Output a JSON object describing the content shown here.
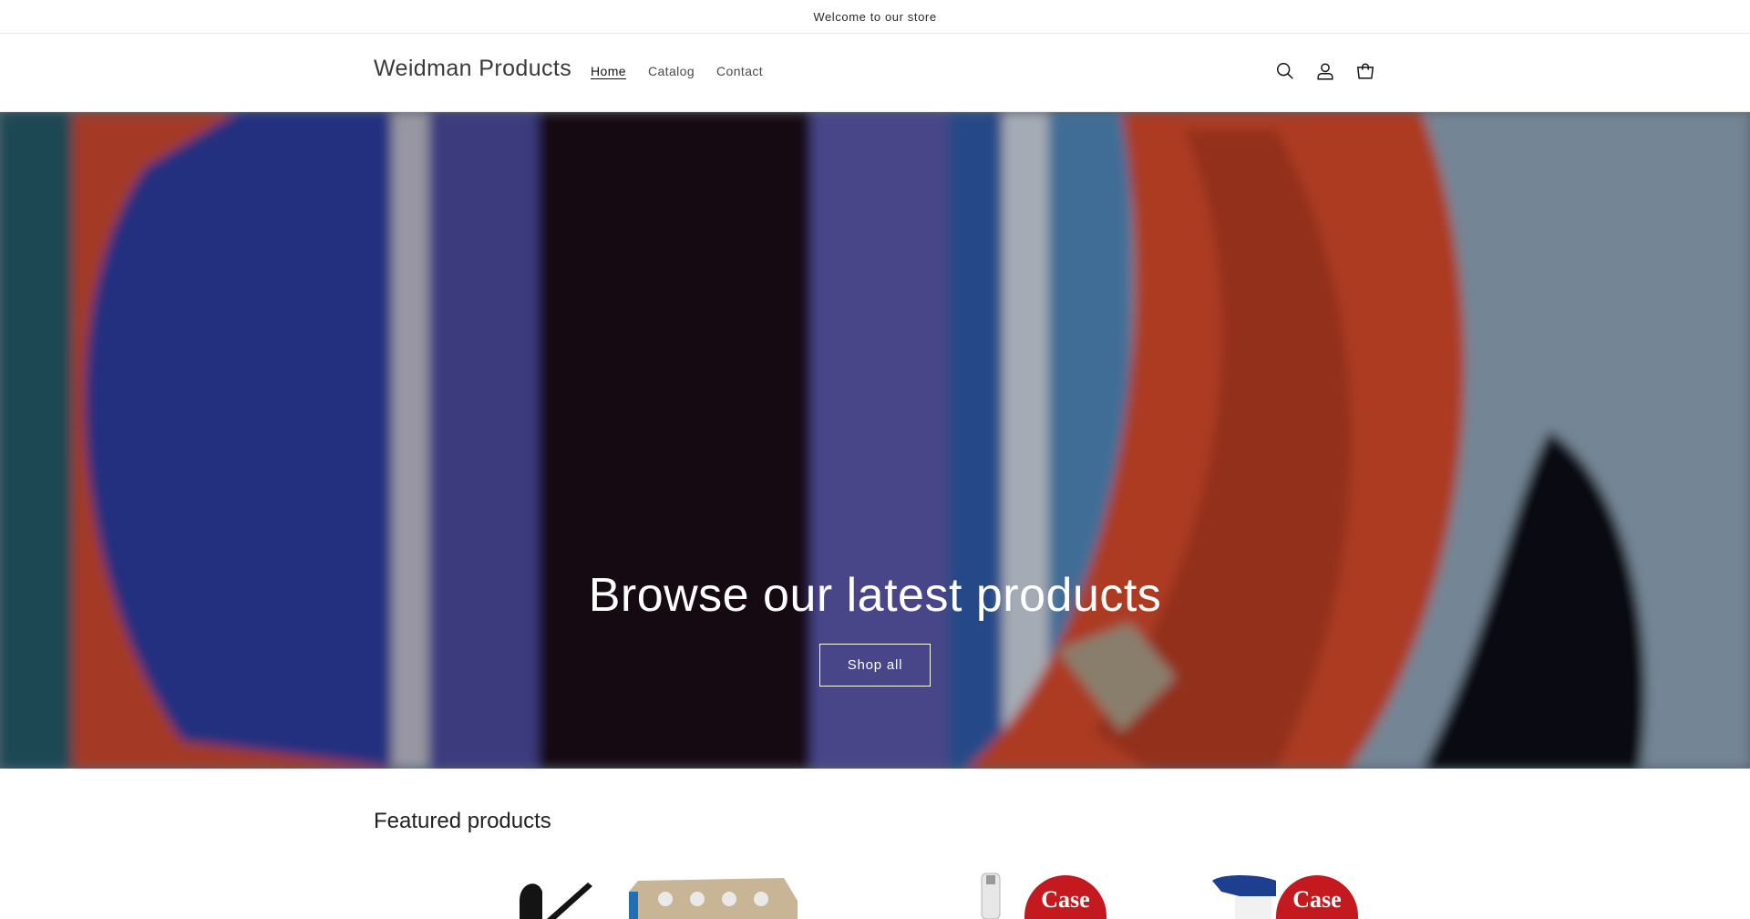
{
  "announcement": {
    "text": "Welcome to our store"
  },
  "header": {
    "logo": "Weidman Products",
    "nav": [
      {
        "label": "Home",
        "active": true
      },
      {
        "label": "Catalog",
        "active": false
      },
      {
        "label": "Contact",
        "active": false
      }
    ],
    "icons": [
      "search-icon",
      "account-icon",
      "cart-icon"
    ]
  },
  "hero": {
    "title": "Browse our latest products",
    "button_label": "Shop all"
  },
  "featured": {
    "title": "Featured products",
    "products": [
      {
        "badge": ""
      },
      {
        "badge": ""
      },
      {
        "badge": "Case"
      },
      {
        "badge": "Case"
      }
    ]
  }
}
